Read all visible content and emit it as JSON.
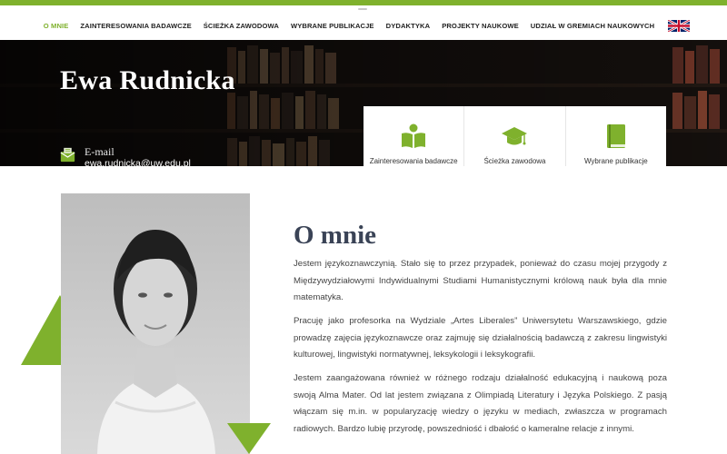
{
  "nav": {
    "items": [
      {
        "label": "O MNIE",
        "active": true
      },
      {
        "label": "ZAINTERESOWANIA BADAWCZE",
        "active": false
      },
      {
        "label": "ŚCIEŻKA ZAWODOWA",
        "active": false
      },
      {
        "label": "WYBRANE PUBLIKACJE",
        "active": false
      },
      {
        "label": "DYDAKTYKA",
        "active": false
      },
      {
        "label": "PROJEKTY NAUKOWE",
        "active": false
      },
      {
        "label": "UDZIAŁ W GREMIACH NAUKOWYCH",
        "active": false
      }
    ],
    "language_icon": "uk-flag-icon"
  },
  "hero": {
    "name": "Ewa Rudnicka",
    "email_label": "E-mail",
    "email": "ewa.rudnicka@uw.edu.pl",
    "email_icon": "mail-icon"
  },
  "cards": [
    {
      "label": "Zainteresowania badawcze",
      "icon": "reading-person-icon"
    },
    {
      "label": "Ścieżka zawodowa",
      "icon": "graduation-cap-icon"
    },
    {
      "label": "Wybrane publikacje",
      "icon": "book-icon"
    }
  ],
  "about": {
    "title": "O mnie",
    "paragraphs": [
      "Jestem językoznawczynią. Stało się to przez przypadek, ponieważ do czasu mojej przygody z Międzywydziałowymi Indywidualnymi Studiami Humanistycznymi królową nauk była dla mnie matematyka.",
      "Pracuję jako profesorka na Wydziale „Artes Liberales” Uniwersytetu Warszawskiego, gdzie prowadzę zajęcia językoznawcze oraz zajmuję się działalnością badawczą z zakresu lingwistyki kulturowej, lingwistyki normatywnej, leksykologii i leksykografii.",
      "Jestem zaangażowana również w różnego rodzaju działalność edukacyjną i naukową poza swoją Alma Mater. Od lat jestem związana z Olimpiadą Literatury i Języka Polskiego. Z pasją włączam się m.in. w popularyzację wiedzy o języku w mediach, zwłaszcza w programach radiowych. Bardzo lubię przyrodę, powszedniość i dbałość o kameralne relacje z innymi."
    ]
  },
  "colors": {
    "accent": "#7fb12d",
    "title": "#3a4356",
    "text": "#444444"
  }
}
